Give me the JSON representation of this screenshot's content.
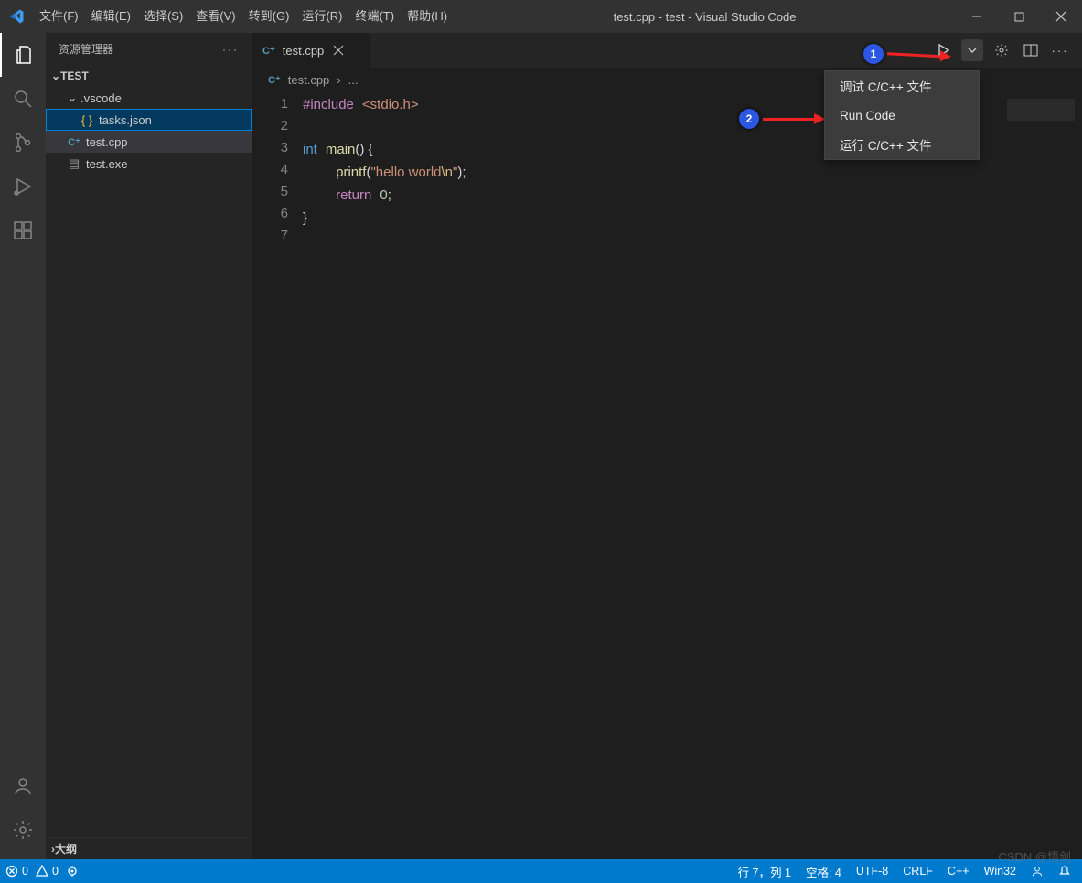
{
  "title": "test.cpp - test - Visual Studio Code",
  "menu": [
    "文件(F)",
    "编辑(E)",
    "选择(S)",
    "查看(V)",
    "转到(G)",
    "运行(R)",
    "终端(T)",
    "帮助(H)"
  ],
  "sidebar": {
    "header": "资源管理器",
    "root": "TEST",
    "items": [
      {
        "label": ".vscode",
        "kind": "folder"
      },
      {
        "label": "tasks.json",
        "kind": "json",
        "selected": true
      },
      {
        "label": "test.cpp",
        "kind": "cpp",
        "focused": true
      },
      {
        "label": "test.exe",
        "kind": "exe"
      }
    ],
    "outline": "大纲"
  },
  "tab": {
    "label": "test.cpp"
  },
  "breadcrumbs": {
    "file": "test.cpp",
    "tail": "..."
  },
  "code": {
    "lines": [
      "1",
      "2",
      "3",
      "4",
      "5",
      "6",
      "7"
    ]
  },
  "run_menu": {
    "items": [
      "调试 C/C++ 文件",
      "Run Code",
      "运行 C/C++ 文件"
    ]
  },
  "callouts": {
    "one": "1",
    "two": "2"
  },
  "status": {
    "errors": "0",
    "warnings": "0",
    "ln_col": "行 7，列 1",
    "spaces": "空格: 4",
    "encoding": "UTF-8",
    "eol": "CRLF",
    "lang": "C++",
    "platform": "Win32"
  },
  "watermark": "CSDN @悟剑"
}
